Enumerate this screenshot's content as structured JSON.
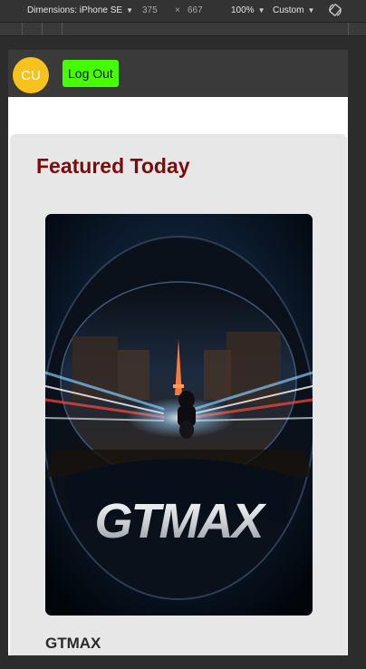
{
  "devtools": {
    "dimensions_label": "Dimensions: iPhone SE",
    "width": "375",
    "times": "×",
    "height": "667",
    "zoom": "100%",
    "throttle": "Custom"
  },
  "header": {
    "avatar_initials": "CU",
    "logout_label": "Log Out"
  },
  "featured": {
    "title": "Featured Today",
    "poster_logo_text": "GTMAX",
    "product_name": "GTMAX"
  },
  "colors": {
    "avatar": "#f7c21b",
    "logout_button": "#44ff00",
    "title": "#7a0c0c",
    "card_bg": "#e7e7e7"
  }
}
